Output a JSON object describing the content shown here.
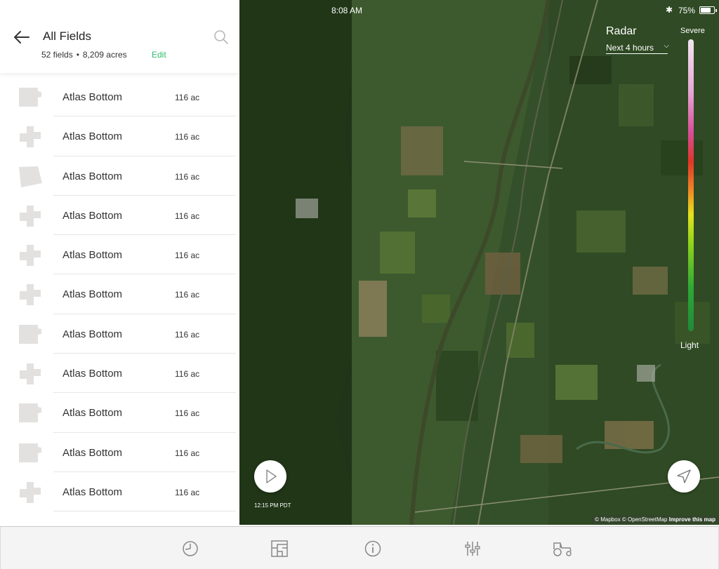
{
  "status_bar": {
    "time": "8:08 AM",
    "battery_percent": "75%"
  },
  "sidebar": {
    "title": "All Fields",
    "field_count": "52 fields",
    "acres_total": "8,209 acres",
    "edit_label": "Edit",
    "fields": [
      {
        "name": "Atlas Bottom",
        "acres": "116 ac",
        "shape": "notched-rect"
      },
      {
        "name": "Atlas Bottom",
        "acres": "116 ac",
        "shape": "cross"
      },
      {
        "name": "Atlas Bottom",
        "acres": "116 ac",
        "shape": "trapezoid"
      },
      {
        "name": "Atlas Bottom",
        "acres": "116 ac",
        "shape": "cross"
      },
      {
        "name": "Atlas Bottom",
        "acres": "116 ac",
        "shape": "cross"
      },
      {
        "name": "Atlas Bottom",
        "acres": "116 ac",
        "shape": "cross"
      },
      {
        "name": "Atlas Bottom",
        "acres": "116 ac",
        "shape": "notched-rect"
      },
      {
        "name": "Atlas Bottom",
        "acres": "116 ac",
        "shape": "cross"
      },
      {
        "name": "Atlas Bottom",
        "acres": "116 ac",
        "shape": "notched-rect"
      },
      {
        "name": "Atlas Bottom",
        "acres": "116 ac",
        "shape": "notched-rect"
      },
      {
        "name": "Atlas Bottom",
        "acres": "116 ac",
        "shape": "cross"
      }
    ]
  },
  "radar": {
    "title": "Radar",
    "timeframe": "Next 4 hours",
    "legend_high": "Severe",
    "legend_low": "Light",
    "playback_time": "12:15 PM PDT"
  },
  "map": {
    "attribution_prefix": "© Mapbox © OpenStreetMap",
    "attribution_improve": "Improve this map"
  },
  "tabbar": {
    "tabs": [
      {
        "icon": "dashboard-gauge-icon"
      },
      {
        "icon": "fields-map-icon"
      },
      {
        "icon": "info-icon"
      },
      {
        "icon": "settings-sliders-icon"
      },
      {
        "icon": "tractor-icon"
      }
    ]
  },
  "colors": {
    "accent_green": "#2ebd6b",
    "field_shape": "#e2e1df",
    "map_dark": "#25391c"
  }
}
